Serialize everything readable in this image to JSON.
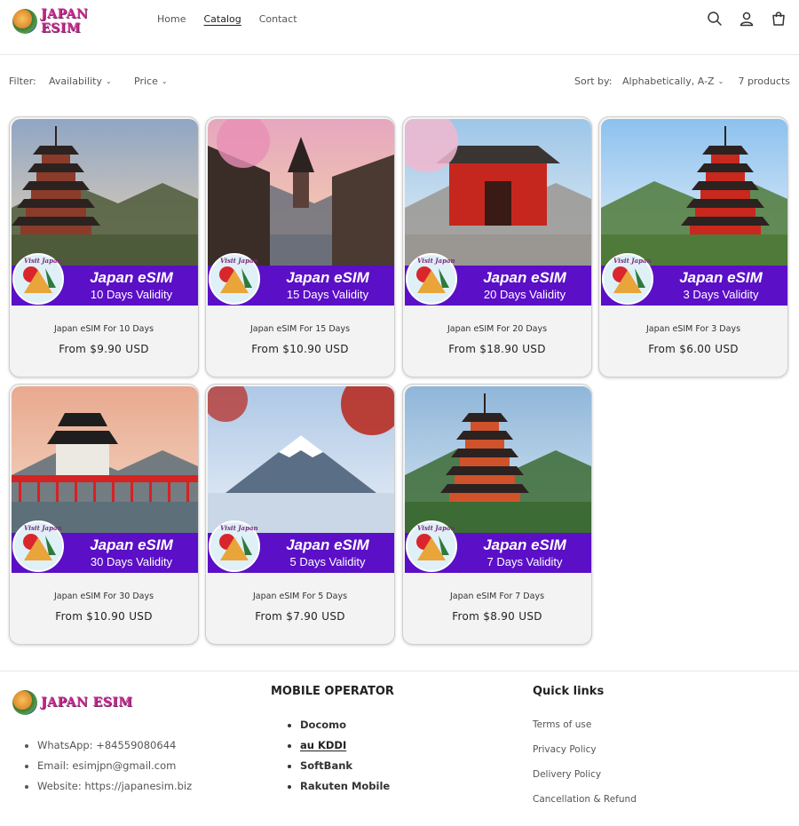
{
  "header": {
    "logo_text": "JAPAN ESIM",
    "nav": [
      {
        "label": "Home",
        "active": false
      },
      {
        "label": "Catalog",
        "active": true
      },
      {
        "label": "Contact",
        "active": false
      }
    ],
    "icons": [
      "search-icon",
      "account-icon",
      "cart-icon"
    ]
  },
  "filterbar": {
    "filter_label": "Filter:",
    "availability": "Availability",
    "price": "Price",
    "sort_label": "Sort by:",
    "sort_value": "Alphabetically, A-Z",
    "count": "7 products"
  },
  "products": [
    {
      "title": "Japan eSIM For 10 Days",
      "price": "From $9.90 USD",
      "banner_title": "Japan eSIM",
      "banner_sub": "10 Days Validity",
      "scene": "pagoda-mountain"
    },
    {
      "title": "Japan eSIM For 15 Days",
      "price": "From $10.90 USD",
      "banner_title": "Japan eSIM",
      "banner_sub": "15 Days Validity",
      "scene": "kyoto-street"
    },
    {
      "title": "Japan eSIM For 20 Days",
      "price": "From $18.90 USD",
      "banner_title": "Japan eSIM",
      "banner_sub": "20 Days Validity",
      "scene": "temple-gate"
    },
    {
      "title": "Japan eSIM For 3 Days",
      "price": "From $6.00 USD",
      "banner_title": "Japan eSIM",
      "banner_sub": "3 Days Validity",
      "scene": "red-pagoda"
    },
    {
      "title": "Japan eSIM For 30 Days",
      "price": "From $10.90 USD",
      "banner_title": "Japan eSIM",
      "banner_sub": "30 Days Validity",
      "scene": "castle-bridge"
    },
    {
      "title": "Japan eSIM For 5 Days",
      "price": "From $7.90 USD",
      "banner_title": "Japan eSIM",
      "banner_sub": "5 Days Validity",
      "scene": "mount-fuji"
    },
    {
      "title": "Japan eSIM For 7 Days",
      "price": "From $8.90 USD",
      "banner_title": "Japan eSIM",
      "banner_sub": "7 Days Validity",
      "scene": "waterfall-pagoda"
    }
  ],
  "badge_text": "Visit Japan",
  "footer": {
    "logo_text": "JAPAN ESIM",
    "contacts": [
      "WhatsApp: +84559080644",
      "Email: esimjpn@gmail.com",
      "Website: https://japanesim.biz"
    ],
    "operator_heading": "MOBILE OPERATOR",
    "operators": [
      {
        "label": "Docomo",
        "linked": false
      },
      {
        "label": "au KDDI",
        "linked": true
      },
      {
        "label": "SoftBank",
        "linked": false
      },
      {
        "label": "Rakuten Mobile",
        "linked": false
      }
    ],
    "quicklinks_heading": "Quick links",
    "quicklinks": [
      "Terms of use",
      "Privacy Policy",
      "Delivery Policy",
      "Cancellation & Refund"
    ]
  },
  "colors": {
    "banner": "#5b0fc7",
    "logo": "#c2298d"
  }
}
